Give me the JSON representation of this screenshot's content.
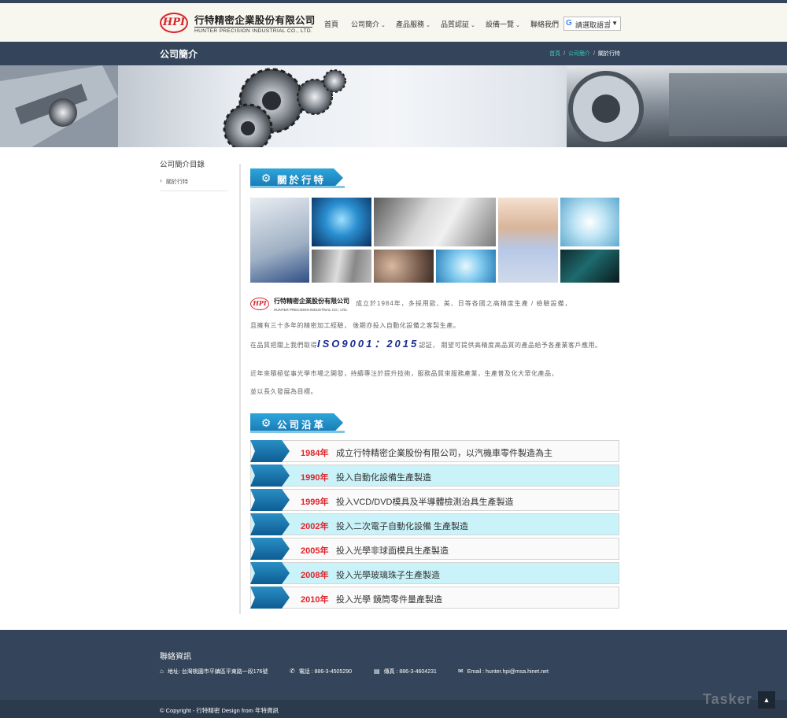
{
  "header": {
    "logo_cn": "行特精密企業股份有限公司",
    "logo_en": "HUNTER PRECISION INDUSTRIAL CO., LTD.",
    "logo_mark": "HPI",
    "nav": [
      {
        "label": "首頁",
        "dropdown": false
      },
      {
        "label": "公司簡介",
        "dropdown": true
      },
      {
        "label": "產品服務",
        "dropdown": true
      },
      {
        "label": "品質認証",
        "dropdown": true
      },
      {
        "label": "設備一覽",
        "dropdown": true
      },
      {
        "label": "聯絡我們",
        "dropdown": false
      }
    ],
    "language": {
      "label": "請選取語言",
      "icon": "G"
    }
  },
  "titlebar": {
    "title": "公司簡介",
    "breadcrumb": [
      "首頁",
      "公司簡介",
      "關於行特"
    ]
  },
  "sidebar": {
    "title": "公司簡介目錄",
    "items": [
      "關於行特"
    ]
  },
  "about": {
    "heading": "關於行特",
    "mini_logo_cn": "行特精密企業股份有限公司",
    "mini_logo_en": "HUNTER PRECISION INDUSTRIAL CO., LTD.",
    "p1": "成立於1984年，多採用歐、美、日等各國之高精度生產 / 檢驗設備，",
    "p2": "且擁有三十多年的精密加工經驗， 後期亦投入自動化設備之客製生產。",
    "p3a": "在品質把關上我們取得",
    "iso": "ISO9001：2015",
    "p3b": "認証， 期望可提供高精度高品質的產品給予各產業客戶應用。",
    "p4": "近年來積極從事光學市場之開發，持續專注於提升技術，服務品質來服務產業，生產普及化大眾化產品，",
    "p5": "並以長久發展為目標。"
  },
  "history": {
    "heading": "公司沿革",
    "entries": [
      {
        "year": "1984年",
        "text": "成立行特精密企業股份有限公司，以汽機車零件製造為主"
      },
      {
        "year": "1990年",
        "text": "投入自動化設備生產製造"
      },
      {
        "year": "1999年",
        "text": "投入VCD/DVD模具及半導體檢測治具生產製造"
      },
      {
        "year": "2002年",
        "text": "投入二次電子自動化設備 生產製造"
      },
      {
        "year": "2005年",
        "text": "投入光學非球面模具生產製造"
      },
      {
        "year": "2008年",
        "text": "投入光學玻璃珠子生產製造"
      },
      {
        "year": "2010年",
        "text": "投入光學 鏡筒零件量產製造"
      }
    ]
  },
  "footer": {
    "title": "聯絡資訊",
    "address": "地址: 台灣桃園市平鎮區平東路一段176號",
    "phone": "電話 : 886-3-4505290",
    "fax": "傳真 : 886-3-4604231",
    "email": "Email : hunter.hpi@msa.hinet.net",
    "copyright": "© Copyright - 行特精密 Design from 年特資訊"
  },
  "watermark": "Tasker",
  "colors": {
    "dark_bar": "#34445a",
    "accent_blue": "#1f88c4",
    "year_red": "#e0242c",
    "row_cyan": "#c9f3f9",
    "link_teal": "#3bc6ba"
  }
}
